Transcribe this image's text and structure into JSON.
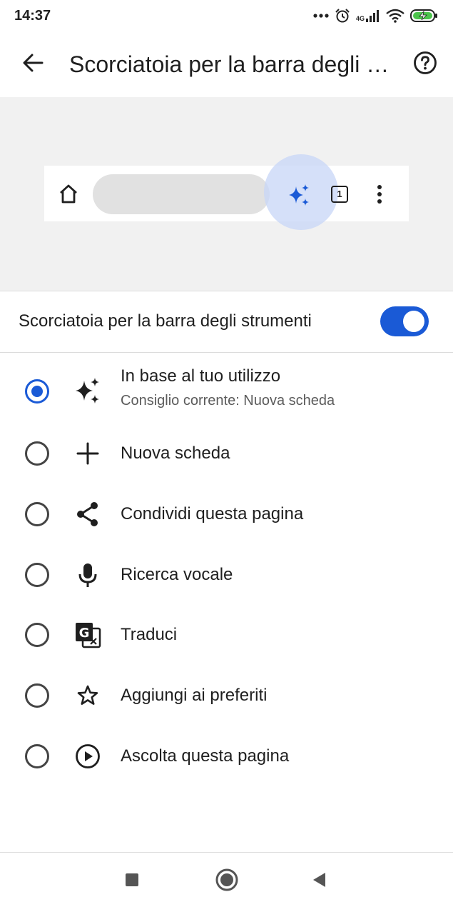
{
  "status_bar": {
    "time": "14:37",
    "network": "4G",
    "icons": [
      "more-dots-icon",
      "alarm-icon",
      "signal-icon",
      "wifi-icon",
      "battery-charging-icon"
    ]
  },
  "app_bar": {
    "title": "Scorciatoia per la barra degli strumenti",
    "back_icon": "arrow-left-icon",
    "help_icon": "help-circle-icon"
  },
  "preview": {
    "tab_count": "1",
    "icons": [
      "home-icon",
      "sparkle-icon",
      "tab-switcher-icon",
      "more-vert-icon"
    ],
    "accent": "#1a5ad6"
  },
  "toggle": {
    "label": "Scorciatoia per la barra degli strumenti",
    "enabled": true
  },
  "options": [
    {
      "label": "In base al tuo utilizzo",
      "sublabel": "Consiglio corrente: Nuova scheda",
      "icon": "sparkle-icon",
      "selected": true
    },
    {
      "label": "Nuova scheda",
      "icon": "plus-icon",
      "selected": false
    },
    {
      "label": "Condividi questa pagina",
      "icon": "share-icon",
      "selected": false
    },
    {
      "label": "Ricerca vocale",
      "icon": "microphone-icon",
      "selected": false
    },
    {
      "label": "Traduci",
      "icon": "translate-icon",
      "selected": false
    },
    {
      "label": "Aggiungi ai preferiti",
      "icon": "star-outline-icon",
      "selected": false
    },
    {
      "label": "Ascolta questa pagina",
      "icon": "play-circle-icon",
      "selected": false
    }
  ],
  "nav_bar": {
    "icons": [
      "recents-square-icon",
      "home-circle-icon",
      "back-triangle-icon"
    ]
  },
  "colors": {
    "accent": "#1a5ad6",
    "preview_background": "#f1f1f1",
    "highlight": "#c7d6f7"
  }
}
